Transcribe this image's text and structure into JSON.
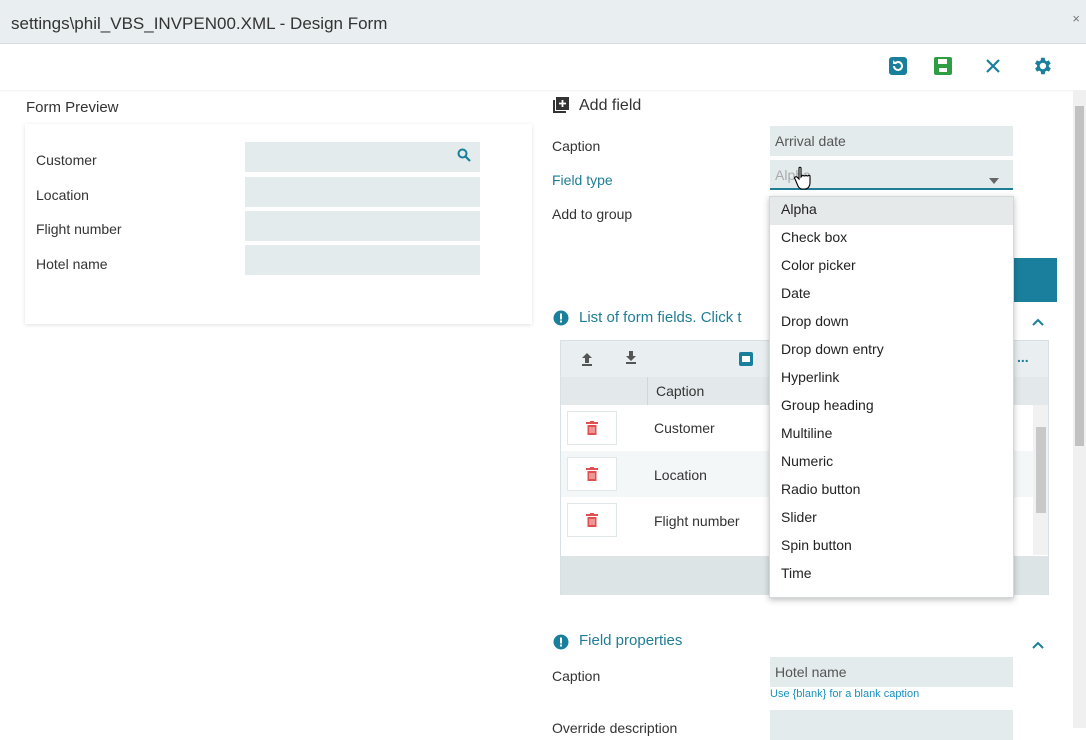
{
  "window": {
    "title": "settings\\phil_VBS_INVPEN00.XML - Design Form",
    "close_glyph": "×"
  },
  "toolbar": {
    "icons": [
      "refresh-icon",
      "save-icon",
      "close-icon",
      "gear-icon"
    ],
    "accent": "#1a7f9c",
    "save_color": "#2e9e45"
  },
  "preview": {
    "heading": "Form Preview",
    "fields": [
      {
        "label": "Customer",
        "has_search": true
      },
      {
        "label": "Location"
      },
      {
        "label": "Flight number"
      },
      {
        "label": "Hotel name"
      }
    ]
  },
  "add_field": {
    "heading": "Add field",
    "caption_label": "Caption",
    "caption_value": "Arrival date",
    "field_type_label": "Field type",
    "field_type_value": "Alpha",
    "add_to_group_label": "Add to group"
  },
  "dropdown": {
    "options": [
      "Alpha",
      "Check box",
      "Color picker",
      "Date",
      "Drop down",
      "Drop down entry",
      "Hyperlink",
      "Group heading",
      "Multiline",
      "Numeric",
      "Radio button",
      "Slider",
      "Spin button",
      "Time"
    ],
    "selected_index": 0
  },
  "list_section": {
    "heading": "List of form fields. Click t",
    "grid_header": "Caption",
    "more_glyph": "...",
    "rows": [
      "Customer",
      "Location",
      "Flight number"
    ]
  },
  "properties": {
    "heading": "Field properties",
    "caption_label": "Caption",
    "caption_value": "Hotel name",
    "hint": "Use {blank} for a blank caption",
    "override_label": "Override description"
  }
}
